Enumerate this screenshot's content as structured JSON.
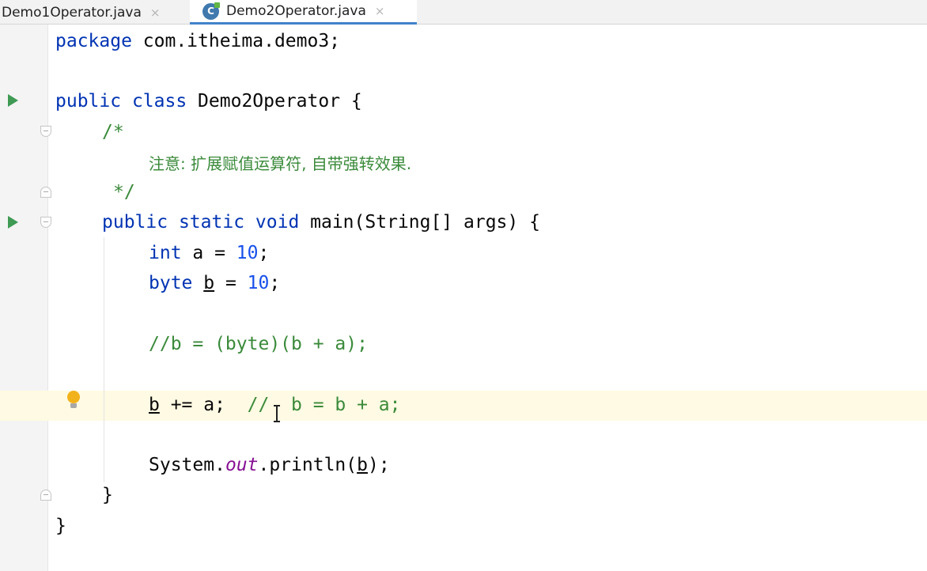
{
  "tabs": [
    {
      "label": "Demo1Operator.java",
      "close": "×",
      "active": false
    },
    {
      "label": "Demo2Operator.java",
      "close": "×",
      "active": true,
      "icon": "java-class-icon",
      "icon_letter": "C"
    }
  ],
  "editor": {
    "lines": {
      "package": {
        "kw": "package",
        "text": " com.itheima.demo3;"
      },
      "class_decl": {
        "kw1": "public",
        "kw2": "class",
        "text": " Demo2Operator {"
      },
      "comment_open": "/*",
      "comment_body": "注意: 扩展赋值运算符, 自带强转效果.",
      "comment_close": "*/",
      "main_decl": {
        "kw1": "public",
        "kw2": "static",
        "kw3": "void",
        "text": " main(String[] args) {"
      },
      "int_decl": {
        "kw": "int",
        "text": " a = ",
        "num": "10",
        "end": ";"
      },
      "byte_decl": {
        "kw": "byte",
        "var": "b",
        "text": " = ",
        "num": "10",
        "end": ";"
      },
      "commented_cast": "//b = (byte)(b + a);",
      "compound": {
        "var": "b",
        "text": " += a;  ",
        "comment": "//  b = b + a;"
      },
      "println": {
        "pre": "System.",
        "field": "out",
        "mid": ".println(",
        "var": "b",
        "end": ");"
      },
      "method_close": "}",
      "class_close": "}"
    }
  },
  "colors": {
    "keyword": "#0033b3",
    "number": "#1750eb",
    "comment": "#3a8a3a",
    "static_field": "#871094",
    "caret_row": "#fffae3",
    "run_arrow": "#3f9a54",
    "active_tab_underline": "#4083c9"
  }
}
